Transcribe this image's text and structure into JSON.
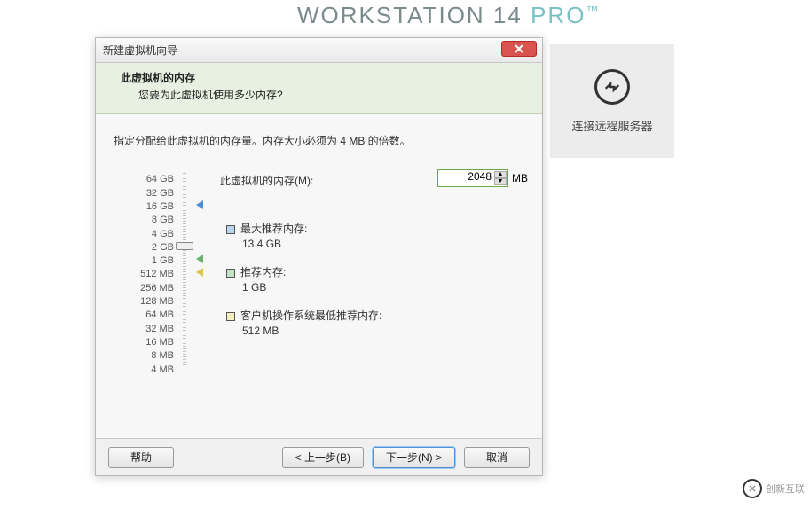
{
  "product": {
    "name": "WORKSTATION 14",
    "edition": "PRO",
    "tm": "™"
  },
  "remote": {
    "label": "连接远程服务器"
  },
  "wizard": {
    "title": "新建虚拟机向导",
    "header_title": "此虚拟机的内存",
    "header_sub": "您要为此虚拟机使用多少内存?",
    "hint": "指定分配给此虚拟机的内存量。内存大小必须为 4 MB 的倍数。",
    "input_label": "此虚拟机的内存(M):",
    "input_value": "2048",
    "unit": "MB",
    "scale": [
      "64 GB",
      "32 GB",
      "16 GB",
      "8 GB",
      "4 GB",
      "2 GB",
      "1 GB",
      "512 MB",
      "256 MB",
      "128 MB",
      "64 MB",
      "32 MB",
      "16 MB",
      "8 MB",
      "4 MB"
    ],
    "reco": [
      {
        "label": "最大推荐内存:",
        "value": "13.4 GB",
        "color": "blue"
      },
      {
        "label": "推荐内存:",
        "value": "1 GB",
        "color": "green"
      },
      {
        "label": "客户机操作系统最低推荐内存:",
        "value": "512 MB",
        "color": "yellow"
      }
    ],
    "buttons": {
      "help": "帮助",
      "back": "< 上一步(B)",
      "next": "下一步(N) >",
      "cancel": "取消"
    }
  },
  "watermark": "创新互联"
}
